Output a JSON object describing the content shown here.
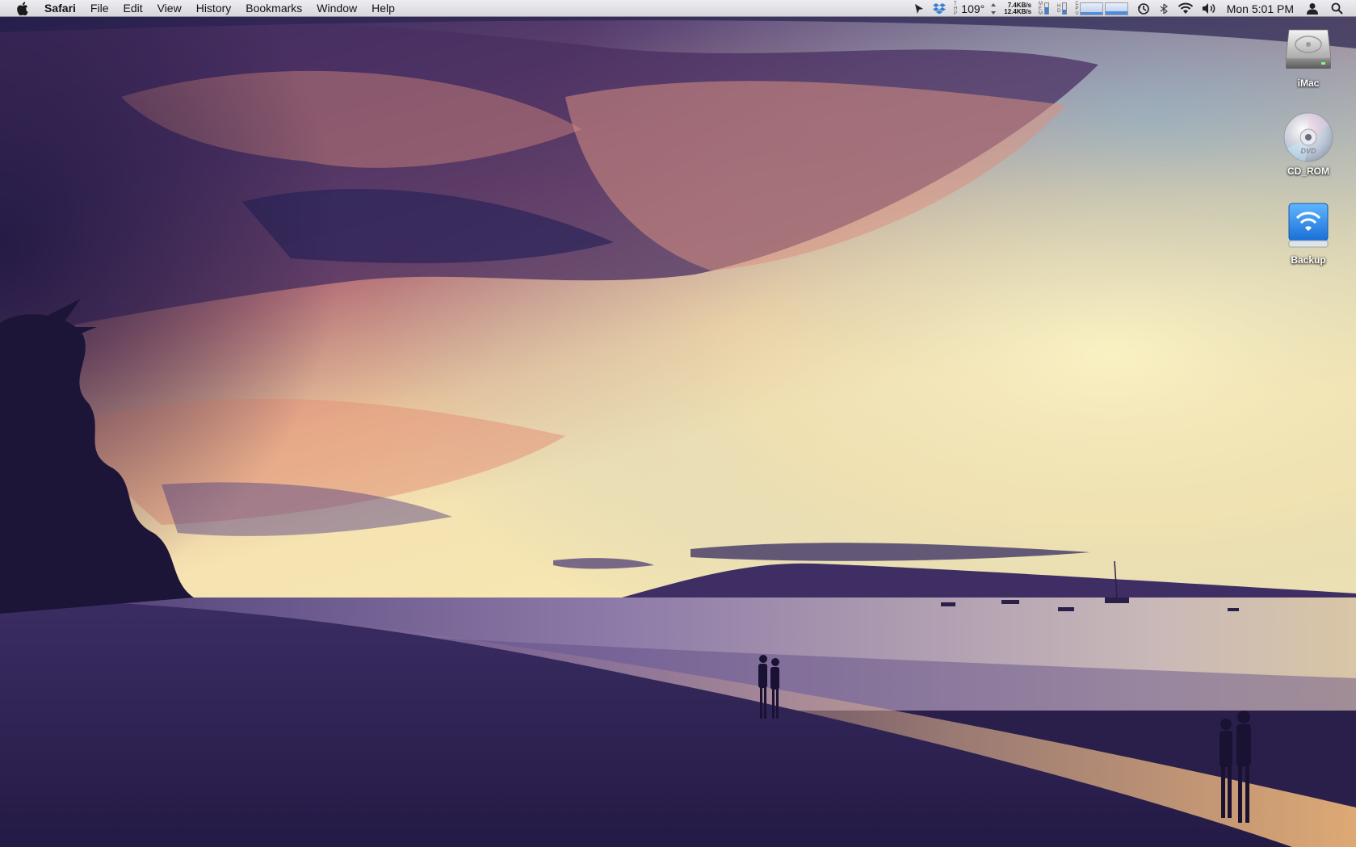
{
  "menubar": {
    "app_name": "Safari",
    "menus": [
      "File",
      "Edit",
      "View",
      "History",
      "Bookmarks",
      "Window",
      "Help"
    ],
    "status": {
      "temperature": "109°",
      "net_up": "7.4KB/s",
      "net_down": "12.4KB/s",
      "clock": "Mon 5:01 PM"
    },
    "icons": [
      "apple-icon",
      "cursor-icon",
      "dropbox-icon",
      "temperature-icon",
      "network-icon",
      "memory-icon",
      "disk-icon",
      "cpu-icon",
      "time-machine-icon",
      "bluetooth-icon",
      "wifi-icon",
      "volume-icon",
      "user-icon",
      "spotlight-icon"
    ]
  },
  "desktop": {
    "icons": [
      {
        "label": "iMac",
        "icon": "hard-drive-icon"
      },
      {
        "label": "CD_ROM",
        "icon": "dvd-icon"
      },
      {
        "label": "Backup",
        "icon": "network-drive-icon"
      }
    ]
  },
  "colors": {
    "sky_top": "#3a2a5e",
    "sky_glow": "#f6e7b0",
    "sea": "#7c6b99",
    "sand": "#2e2350",
    "accent": "#4d8de0"
  }
}
